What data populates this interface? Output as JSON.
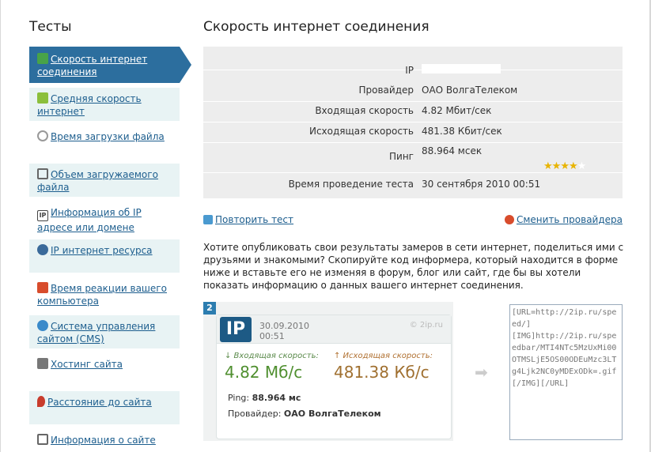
{
  "sidebar": {
    "title": "Тесты",
    "items": [
      {
        "label": "Скорость интернет соединения",
        "icon": "speed-icon",
        "color": "#48a348"
      },
      {
        "label": "Средняя скорость интернет",
        "icon": "bars-icon",
        "color": "#8bbf3c"
      },
      {
        "label": "Время загрузки файла",
        "icon": "clock-icon",
        "color": "#999999"
      },
      {
        "label": "Объем загружаемого файла",
        "icon": "monitor-icon",
        "color": "#666666"
      },
      {
        "label": "Информация об IP адресе или домене",
        "icon": "ip-icon",
        "color": "#444444"
      },
      {
        "label": "IP интернет ресурса",
        "icon": "ip-globe-icon",
        "color": "#3a6a9a"
      },
      {
        "label": "Время реакции вашего компьютера",
        "icon": "reaction-icon",
        "color": "#d84c2c"
      },
      {
        "label": "Система управления сайтом (CMS)",
        "icon": "cms-icon",
        "color": "#3a8aca"
      },
      {
        "label": "Хостинг сайта",
        "icon": "server-icon",
        "color": "#777777"
      },
      {
        "label": "Расстояние до сайта",
        "icon": "pin-icon",
        "color": "#c83c2c"
      },
      {
        "label": "Информация о сайте",
        "icon": "document-icon",
        "color": "#666666"
      }
    ]
  },
  "main": {
    "title": "Скорость интернет соединения",
    "results": [
      {
        "label": "IP",
        "value": ""
      },
      {
        "label": "Провайдер",
        "value": "ОАО ВолгаТелеком"
      },
      {
        "label": "Входящая скорость",
        "value": "4.82 Мбит/сек"
      },
      {
        "label": "Исходящая скорость",
        "value": "481.38 Кбит/сек"
      },
      {
        "label": "Пинг",
        "value": "88.964 мсек"
      },
      {
        "label": "Время проведение теста",
        "value": "30 сентября 2010 00:51"
      }
    ],
    "ping_rating": {
      "stars_filled": 4,
      "stars_total": 5
    },
    "repeat_link": "Повторить тест",
    "change_provider_link": "Сменить провайдера",
    "description": "Хотите опубликовать свои результаты замеров в сети интернет, поделиться ими с друзьями и знакомыми? Скопируйте код информера, который находится в форме ниже и вставьте его не изменяя в форум, блог или сайт, где бы вы хотели показать информацию о данных вашего интернет соединения."
  },
  "informer": {
    "badge": "2",
    "logo": "IP",
    "date": "30.09.2010",
    "time": "00:51",
    "source": "© 2ip.ru",
    "download_label": "↓ Входящая скорость:",
    "download_value": "4.82 Мб/с",
    "upload_label": "↑ Исходящая скорость:",
    "upload_value": "481.38 Кб/с",
    "ping_label": "Ping:",
    "ping_value": "88.964 мс",
    "provider_label": "Провайдер:",
    "provider_value": "ОАО ВолгаТелеком",
    "code": "[URL=http://2ip.ru/speed/][IMG]http://2ip.ru/speedbar/MTI4NTc5MzUxMi00OTMSLjE5OS00ODEuMzc3LTg4Ljk2NC0yMDExODk=.gif[/IMG][/URL]"
  },
  "colors": {
    "accent": "#2c6e9e",
    "link": "#1d5e8e",
    "panel_bg": "#ededed",
    "menu_alt_bg": "#e8f3f4"
  }
}
